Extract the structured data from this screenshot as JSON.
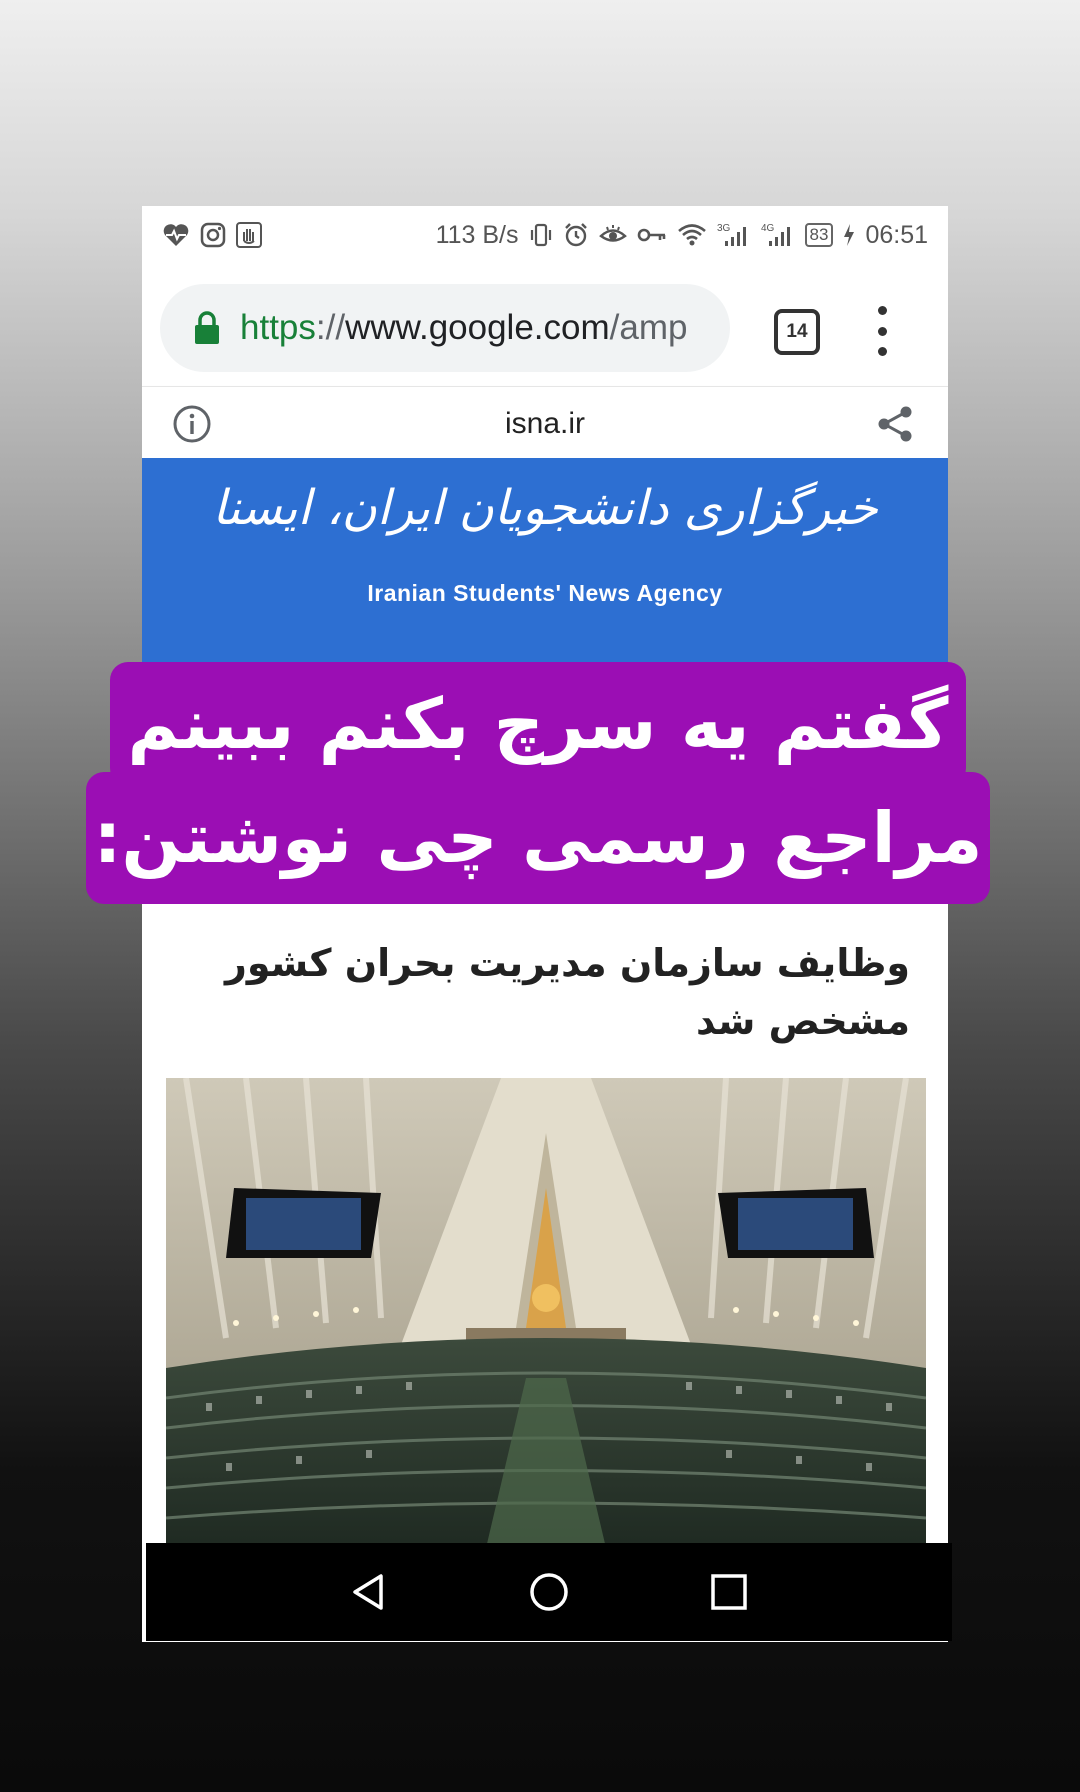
{
  "status_bar": {
    "speed": "113 B/s",
    "signal_3g": "3G",
    "signal_4g": "4G",
    "battery": "83",
    "time": "06:51"
  },
  "browser": {
    "url_scheme": "https",
    "url_separator": "://",
    "url_host": "www.google.com",
    "url_path": "/amp",
    "tab_count": "14"
  },
  "amp_header": {
    "domain": "isna.ir"
  },
  "banner": {
    "logo_persian": "خبرگزاری دانشجویان ایران، ایسنا",
    "logo_english": "Iranian Students' News Agency"
  },
  "caption": {
    "line1": "گفتم یه سرچ بکنم ببینم",
    "line2": "مراجع رسمی چی نوشتن:"
  },
  "article": {
    "headline": "وظایف سازمان مدیریت بحران کشور مشخص شد"
  }
}
